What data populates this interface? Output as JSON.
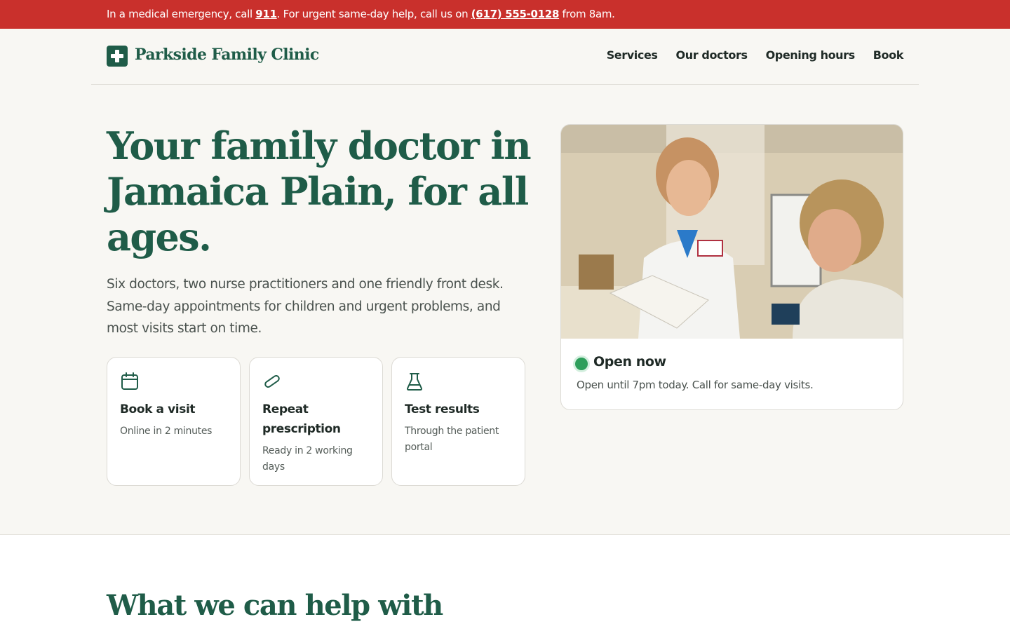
{
  "alert": {
    "prefix": "In a medical emergency, call ",
    "emergency_number": "911",
    "middle": ". For urgent same-day help, call us on ",
    "phone": "(617) 555-0128",
    "suffix": " from 8am."
  },
  "header": {
    "brand": "Parkside Family Clinic",
    "logo_icon": "medical-cross-icon",
    "nav": [
      "Services",
      "Our doctors",
      "Opening hours",
      "Book"
    ]
  },
  "hero": {
    "title": "Your family doctor in Jamaica Plain, for all ages.",
    "subtitle": "Six doctors, two nurse practitioners and one friendly front desk. Same-day appointments for children and urgent problems, and most visits start on time."
  },
  "tiles": [
    {
      "icon": "calendar-icon",
      "title": "Book a visit",
      "subtitle": "Online in 2 minutes"
    },
    {
      "icon": "pill-icon",
      "title": "Repeat prescription",
      "subtitle": "Ready in 2 working days"
    },
    {
      "icon": "flask-icon",
      "title": "Test results",
      "subtitle": "Through the patient portal"
    }
  ],
  "status_card": {
    "status": "Open now",
    "detail": "Open until 7pm today. Call for same-day visits.",
    "status_color": "#2e9e5b"
  },
  "section": {
    "title": "What we can help with"
  },
  "colors": {
    "brand_green": "#1f5c48",
    "alert_red": "#c9302c",
    "hero_background": "#f8f7f3"
  }
}
